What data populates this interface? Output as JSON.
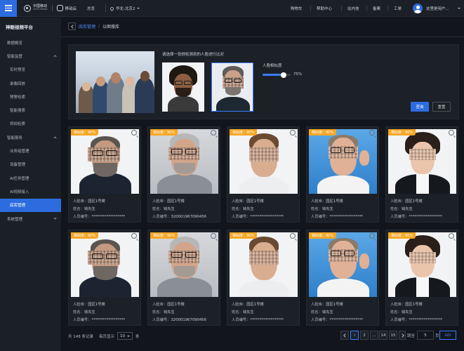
{
  "topbar": {
    "brand_cn": "中国移动",
    "brand_en": "China Mobile",
    "cloud": "移动云",
    "overview": "总览",
    "region": "华北-北京2",
    "nav": [
      "购物车",
      "帮助中心",
      "站内信",
      "备案",
      "工单"
    ],
    "username": "这里是用户..."
  },
  "sidebar": {
    "title": "神眼视频平台",
    "items": [
      {
        "label": "数据概览"
      },
      {
        "label": "智能监管"
      },
      {
        "label": "实时预览"
      },
      {
        "label": "录像回放"
      },
      {
        "label": "预警检索"
      },
      {
        "label": "智能搜索"
      },
      {
        "label": "抓拍检索"
      },
      {
        "label": "智能服务"
      },
      {
        "label": "业务组管理"
      },
      {
        "label": "设备管理"
      },
      {
        "label": "AI任务管理"
      },
      {
        "label": "AI视频接入"
      },
      {
        "label": "底库管理"
      },
      {
        "label": "系统管理"
      }
    ]
  },
  "breadcrumb": {
    "parent": "底库管理",
    "sep": "/",
    "current": "以图搜库"
  },
  "search": {
    "prompt": "请选择一张他检测到的人脸进行比对",
    "similarity_label": "人脸相似度",
    "similarity_value": "75%",
    "similarity_fraction": 0.75,
    "query": "查询",
    "reset": "重置"
  },
  "cards": [
    {
      "badge": "相似度：90%",
      "lib_label": "人脸库：",
      "lib": "园区1号楼",
      "name_label": "姓名：",
      "name": "钱先生",
      "id_label": "人员编号：",
      "id": "******************"
    },
    {
      "badge": "相似度：90%",
      "lib_label": "人脸库：",
      "lib": "园区1号楼",
      "name_label": "姓名：",
      "name": "钱先生",
      "id_label": "人员编号：",
      "id": "320001967090456"
    },
    {
      "badge": "相似度：90%",
      "lib_label": "人脸库：",
      "lib": "园区1号楼",
      "name_label": "姓名：",
      "name": "钱先生",
      "id_label": "人员编号：",
      "id": "******************"
    },
    {
      "badge": "相似度：90%",
      "lib_label": "人脸库：",
      "lib": "园区1号楼",
      "name_label": "姓名：",
      "name": "钱先生",
      "id_label": "人员编号：",
      "id": "******************"
    },
    {
      "badge": "相似度：90%",
      "lib_label": "人脸库：",
      "lib": "园区1号楼",
      "name_label": "姓名：",
      "name": "钱先生",
      "id_label": "人员编号：",
      "id": "******************"
    },
    {
      "badge": "相似度：90%",
      "lib_label": "人脸库：",
      "lib": "园区1号楼",
      "name_label": "姓名：",
      "name": "钱先生",
      "id_label": "人员编号：",
      "id": "******************"
    },
    {
      "badge": "相似度：90%",
      "lib_label": "人脸库：",
      "lib": "园区1号楼",
      "name_label": "姓名：",
      "name": "钱先生",
      "id_label": "人员编号：",
      "id": "320001967090456"
    },
    {
      "badge": "相似度：90%",
      "lib_label": "人脸库：",
      "lib": "园区1号楼",
      "name_label": "姓名：",
      "name": "钱先生",
      "id_label": "人员编号：",
      "id": "******************"
    },
    {
      "badge": "相似度：90%",
      "lib_label": "人脸库：",
      "lib": "园区1号楼",
      "name_label": "姓名：",
      "name": "钱先生",
      "id_label": "人员编号：",
      "id": "******************"
    },
    {
      "badge": "相似度：90%",
      "lib_label": "人脸库：",
      "lib": "园区1号楼",
      "name_label": "姓名：",
      "name": "钱先生",
      "id_label": "人员编号：",
      "id": "******************"
    }
  ],
  "footer": {
    "total": "共 148 条记录",
    "per_page_label": "每页显示",
    "per_page": "10",
    "per_page_unit": "条",
    "pages": [
      "1",
      "2",
      "...",
      "14",
      "15"
    ],
    "jump_label": "跳至",
    "jump_value": "5",
    "page_unit": "页",
    "go": "GO"
  }
}
